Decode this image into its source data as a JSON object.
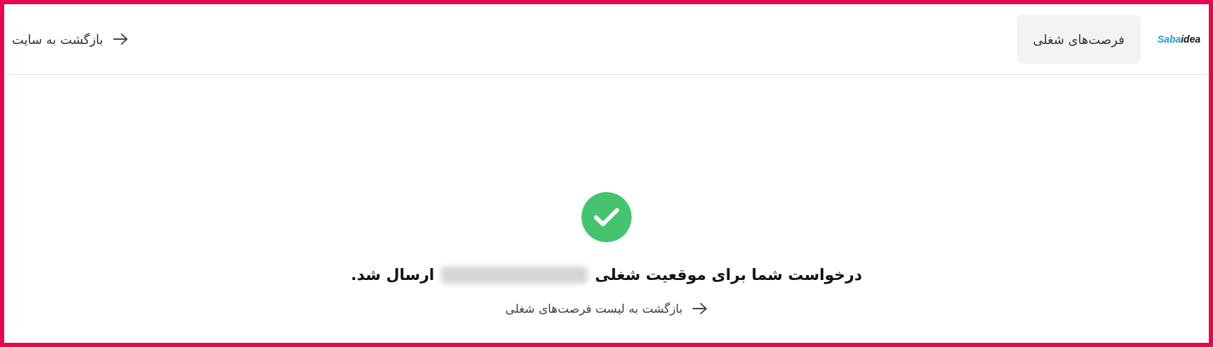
{
  "header": {
    "logo": {
      "part_1": "Saba",
      "part_2": "idea"
    },
    "tabs": [
      {
        "label": "فرصت‌های شغلی",
        "selected": true
      }
    ],
    "back_link": "بازگشت به سایت"
  },
  "confirmation": {
    "kind": "success",
    "message_start": "درخواست شما برای موقعیت شغلی",
    "job_title_redacted": true,
    "message_end": "ارسال شد.",
    "link": "بازگشت به لیست فرصت‌های شغلی"
  }
}
